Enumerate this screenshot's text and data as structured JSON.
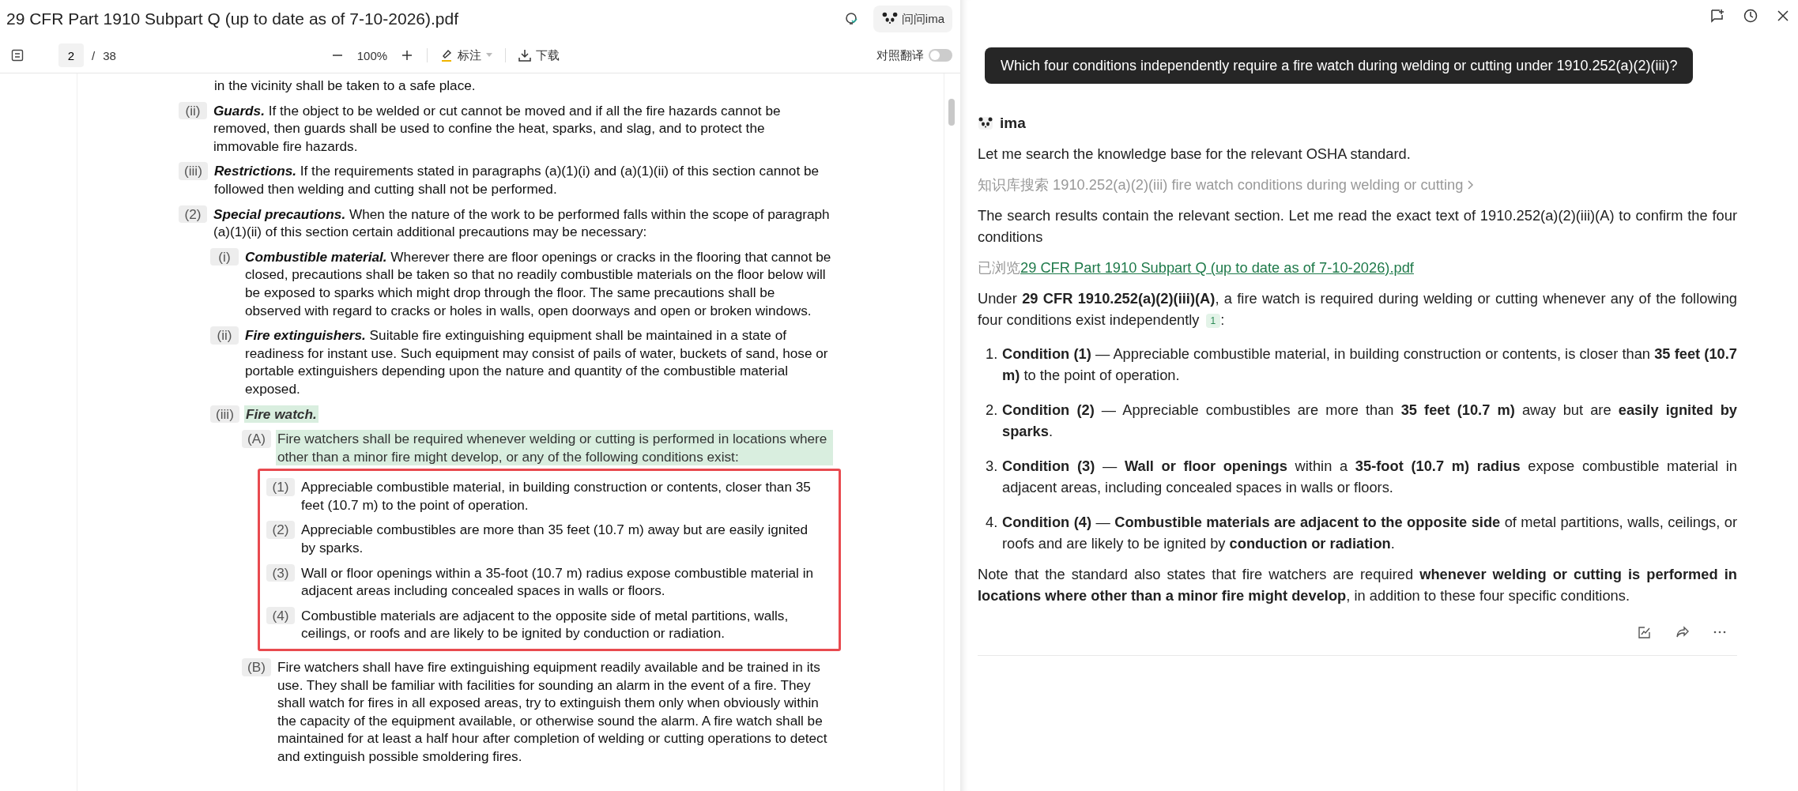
{
  "pdf": {
    "title": "29 CFR Part 1910 Subpart Q (up to date as of 7-10-2026).pdf",
    "ask_button": "问问ima",
    "page": "2",
    "page_separator": "/",
    "page_total": "38",
    "zoom": "100%",
    "annotate": "标注",
    "download": "下载",
    "translate": {
      "label": "对照翻译",
      "on": false
    },
    "outline": [
      {
        "children": [
          {
            "text": "in the vicinity shall be taken to a safe place."
          },
          {
            "label": "(ii)",
            "heading": "Guards.",
            "text": "If the object to be welded or cut cannot be moved and if all the fire hazards cannot be removed, then guards shall be used to confine the heat, sparks, and slag, and to protect the immovable fire hazards.",
            "highlighted": false
          },
          {
            "label": "(iii)",
            "heading": "Restrictions.",
            "text": "If the requirements stated in paragraphs (a)(1)(i) and (a)(1)(ii) of this section cannot be followed then welding and cutting shall not be performed.",
            "highlighted": false
          }
        ]
      },
      {
        "label": "(2)",
        "heading": "Special precautions.",
        "text": "When the nature of the work to be performed falls within the scope of paragraph (a)(1)(ii) of this section certain additional precautions may be necessary:",
        "highlighted": false,
        "children": [
          {
            "label": "(i)",
            "heading": "Combustible material.",
            "text": "Wherever there are floor openings or cracks in the flooring that cannot be closed, precautions shall be taken so that no readily combustible materials on the floor below will be exposed to sparks which might drop through the floor. The same precautions shall be observed with regard to cracks or holes in walls, open doorways and open or broken windows.",
            "highlighted": false
          },
          {
            "label": "(ii)",
            "heading": "Fire extinguishers.",
            "text": "Suitable fire extinguishing equipment shall be maintained in a state of readiness for instant use. Such equipment may consist of pails of water, buckets of sand, hose or portable extinguishers depending upon the nature and quantity of the combustible material exposed.",
            "highlighted": false
          },
          {
            "label": "(iii)",
            "heading": "Fire watch.",
            "highlighted": true,
            "children": [
              {
                "label": "(A)",
                "text": "Fire watchers shall be required whenever welding or cutting is performed in locations where other than a minor fire might develop, or any of the following conditions exist:",
                "highlighted": true,
                "children_framed": true,
                "children": [
                  {
                    "label": "(1)",
                    "text": "Appreciable combustible material, in building construction or contents, closer than 35 feet (10.7 m) to the point of operation.",
                    "highlighted": false
                  },
                  {
                    "label": "(2)",
                    "text": "Appreciable combustibles are more than 35 feet (10.7 m) away but are easily ignited by sparks.",
                    "highlighted": false
                  },
                  {
                    "label": "(3)",
                    "text": "Wall or floor openings within a 35-foot (10.7 m) radius expose combustible material in adjacent areas including concealed spaces in walls or floors.",
                    "highlighted": false
                  },
                  {
                    "label": "(4)",
                    "text": "Combustible materials are adjacent to the opposite side of metal partitions, walls, ceilings, or roofs and are likely to be ignited by conduction or radiation.",
                    "highlighted": false
                  }
                ]
              },
              {
                "label": "(B)",
                "text": "Fire watchers shall have fire extinguishing equipment readily available and be trained in its use. They shall be familiar with facilities for sounding an alarm in the event of a fire. They shall watch for fires in all exposed areas, try to extinguish them only when obviously within the capacity of the equipment available, or otherwise sound the alarm. A fire watch shall be maintained for at least a half hour after completion of welding or cutting operations to detect and extinguish possible smoldering fires.",
                "highlighted": false
              }
            ]
          }
        ]
      }
    ]
  },
  "chat": {
    "question": "Which four conditions independently require a fire watch during welding or cutting under 1910.252(a)(2)(iii)?",
    "author": "ima",
    "blocks": [
      {
        "kind": "text",
        "text": "Let me search the knowledge base for the relevant OSHA standard."
      },
      {
        "kind": "tool",
        "text": "知识库搜索 1910.252(a)(2)(iii) fire watch conditions during welding or cutting"
      },
      {
        "kind": "text",
        "text": "The search results contain the relevant section. Let me read the exact text of 1910.252(a)(2)(iii)(A) to confirm the four conditions"
      },
      {
        "kind": "browsed",
        "prefix": "已浏览",
        "link": "29 CFR Part 1910 Subpart Q (up to date as of 7-10-2026).pdf"
      },
      {
        "kind": "text",
        "text": "Under **29 CFR 1910.252(a)(2)(iii)(A)**, a fire watch is required during welding or cutting whenever any of the following four conditions exist independently",
        "citation": "1",
        "tail": ":"
      },
      {
        "kind": "list",
        "items": [
          {
            "number": "1.",
            "text": "**Condition (1)** — Appreciable combustible material, in building construction or contents, is closer than **35 feet (10.7 m)** to the point of operation."
          },
          {
            "number": "2.",
            "text": "**Condition (2)** — Appreciable combustibles are more than **35 feet (10.7 m)** away but are **easily ignited by sparks**."
          },
          {
            "number": "3.",
            "text": "**Condition (3)** — **Wall or floor openings** within a **35-foot (10.7 m) radius** expose combustible material in adjacent areas, including concealed spaces in walls or floors."
          },
          {
            "number": "4.",
            "text": "**Condition (4)** — **Combustible materials are adjacent to the opposite side** of metal partitions, walls, ceilings, or roofs and are likely to be ignited by **conduction or radiation**."
          }
        ]
      },
      {
        "kind": "text",
        "text": "Note that the standard also states that fire watchers are required **whenever welding or cutting is performed in locations where other than a minor fire might develop**, in addition to these four specific conditions."
      }
    ]
  }
}
